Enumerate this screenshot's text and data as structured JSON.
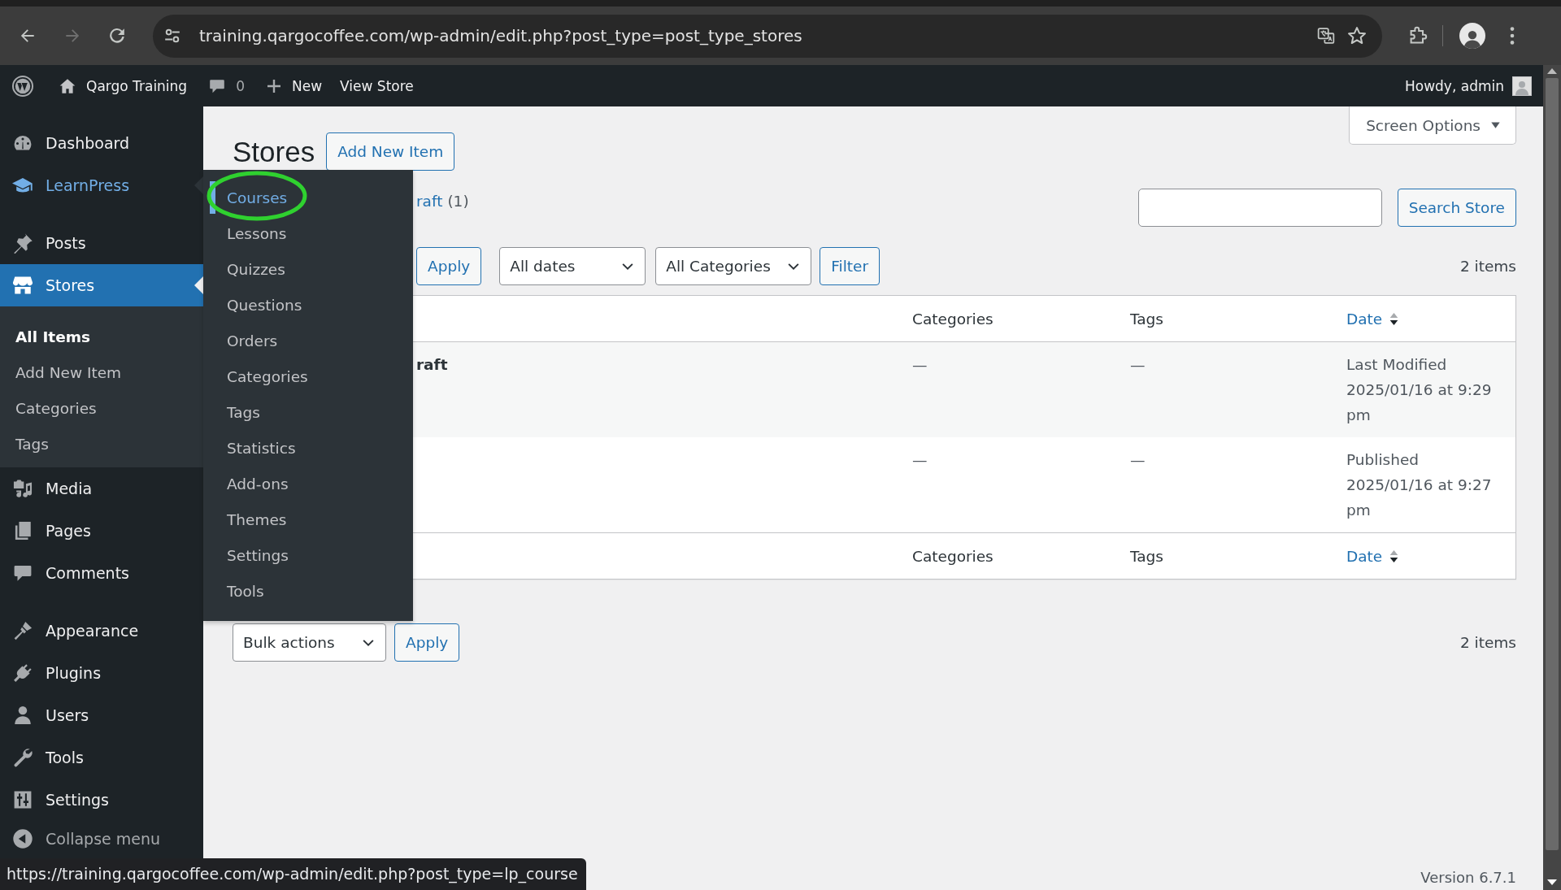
{
  "browser": {
    "url": "training.qargocoffee.com/wp-admin/edit.php?post_type=post_type_stores",
    "forward_disabled": true
  },
  "admin_bar": {
    "site_name": "Qargo Training",
    "comment_count": "0",
    "new_label": "New",
    "view_label": "View Store",
    "greeting": "Howdy, admin"
  },
  "sidebar": {
    "groups": [
      [
        {
          "label": "Dashboard",
          "selected": false,
          "hovered": false
        },
        {
          "label": "LearnPress",
          "selected": false,
          "hovered": true
        }
      ],
      [
        {
          "label": "Posts",
          "selected": false,
          "hovered": false
        },
        {
          "label": "Stores",
          "selected": true,
          "hovered": false,
          "submenu": [
            {
              "label": "All Items",
              "selected": true
            },
            {
              "label": "Add New Item",
              "selected": false
            },
            {
              "label": "Categories",
              "selected": false
            },
            {
              "label": "Tags",
              "selected": false
            }
          ]
        },
        {
          "label": "Media",
          "selected": false,
          "hovered": false
        },
        {
          "label": "Pages",
          "selected": false,
          "hovered": false
        },
        {
          "label": "Comments",
          "selected": false,
          "hovered": false
        }
      ],
      [
        {
          "label": "Appearance",
          "selected": false,
          "hovered": false
        },
        {
          "label": "Plugins",
          "selected": false,
          "hovered": false
        },
        {
          "label": "Users",
          "selected": false,
          "hovered": false
        },
        {
          "label": "Tools",
          "selected": false,
          "hovered": false
        },
        {
          "label": "Settings",
          "selected": false,
          "hovered": false
        }
      ]
    ],
    "collapse_label": "Collapse menu"
  },
  "flyout": {
    "items": [
      {
        "label": "Courses",
        "hovered": true,
        "circled": true
      },
      {
        "label": "Lessons",
        "hovered": false,
        "circled": false
      },
      {
        "label": "Quizzes",
        "hovered": false,
        "circled": false
      },
      {
        "label": "Questions",
        "hovered": false,
        "circled": false
      },
      {
        "label": "Orders",
        "hovered": false,
        "circled": false
      },
      {
        "label": "Categories",
        "hovered": false,
        "circled": false
      },
      {
        "label": "Tags",
        "hovered": false,
        "circled": false
      },
      {
        "label": "Statistics",
        "hovered": false,
        "circled": false
      },
      {
        "label": "Add-ons",
        "hovered": false,
        "circled": false
      },
      {
        "label": "Themes",
        "hovered": false,
        "circled": false
      },
      {
        "label": "Settings",
        "hovered": false,
        "circled": false
      },
      {
        "label": "Tools",
        "hovered": false,
        "circled": false
      }
    ]
  },
  "page": {
    "title": "Stores",
    "add_new": "Add New Item",
    "screen_options": "Screen Options",
    "views": [
      {
        "label": "raft",
        "count": "(1)"
      }
    ],
    "search_button": "Search Store",
    "top_nav": {
      "apply": "Apply",
      "filters": [
        "All dates",
        "All Categories"
      ],
      "filter_button": "Filter",
      "count": "2 items"
    },
    "table": {
      "columns": [
        {
          "label": "Categories",
          "sortable": false
        },
        {
          "label": "Tags",
          "sortable": false
        },
        {
          "label": "Date",
          "sortable": true
        }
      ],
      "rows": [
        {
          "title": "raft",
          "categories": "—",
          "tags": "—",
          "date_status": "Last Modified",
          "date": "2025/01/16 at 9:29 pm"
        },
        {
          "categories": "—",
          "tags": "—",
          "date_status": "Published",
          "date": "2025/01/16 at 9:27 pm"
        }
      ],
      "footer_columns": [
        {
          "label": "Categories",
          "sortable": false
        },
        {
          "label": "Tags",
          "sortable": false
        },
        {
          "label": "Date",
          "sortable": true
        }
      ]
    },
    "bottom_nav": {
      "bulk_actions": "Bulk actions",
      "apply": "Apply",
      "count": "2 items"
    },
    "version": "Version 6.7.1"
  },
  "status_link": "https://training.qargocoffee.com/wp-admin/edit.php?post_type=lp_course"
}
